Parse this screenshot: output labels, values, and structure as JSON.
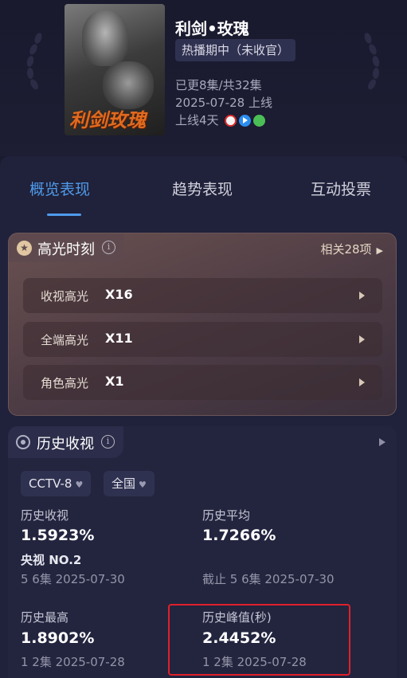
{
  "show": {
    "title": "利剑•玫瑰",
    "status": "热播期中（未收官）",
    "episodes": "已更8集/共32集",
    "air_date": "2025-07-28 上线",
    "days_online": "上线4天",
    "poster_title": "利剑玫瑰",
    "platforms": [
      "cctv-icon",
      "play-icon",
      "iqiyi-icon"
    ]
  },
  "tabs": [
    {
      "label": "概览表现",
      "active": true
    },
    {
      "label": "趋势表现",
      "active": false
    },
    {
      "label": "互动投票",
      "active": false
    }
  ],
  "highlights": {
    "title": "高光时刻",
    "related": "相关28项",
    "rows": [
      {
        "label": "收视高光",
        "count": "X16"
      },
      {
        "label": "全端高光",
        "count": "X11"
      },
      {
        "label": "角色高光",
        "count": "X1"
      }
    ]
  },
  "history": {
    "title": "历史收视",
    "filters": {
      "channel": "CCTV-8",
      "region": "全国"
    },
    "stats": {
      "hist_rating": {
        "label": "历史收视",
        "value": "1.5923%",
        "rank": "央视 NO.2",
        "sub": "5 6集 2025-07-30"
      },
      "hist_avg": {
        "label": "历史平均",
        "value": "1.7266%",
        "sub": "截止 5 6集 2025-07-30"
      },
      "hist_max": {
        "label": "历史最高",
        "value": "1.8902%",
        "sub": "1 2集 2025-07-28"
      },
      "hist_peak": {
        "label": "历史峰值(秒)",
        "value": "2.4452%",
        "sub": "1 2集 2025-07-28"
      }
    }
  },
  "colors": {
    "accent": "#4f9bea",
    "highlight_box": "#e0202a",
    "background": "#1b1b30"
  }
}
